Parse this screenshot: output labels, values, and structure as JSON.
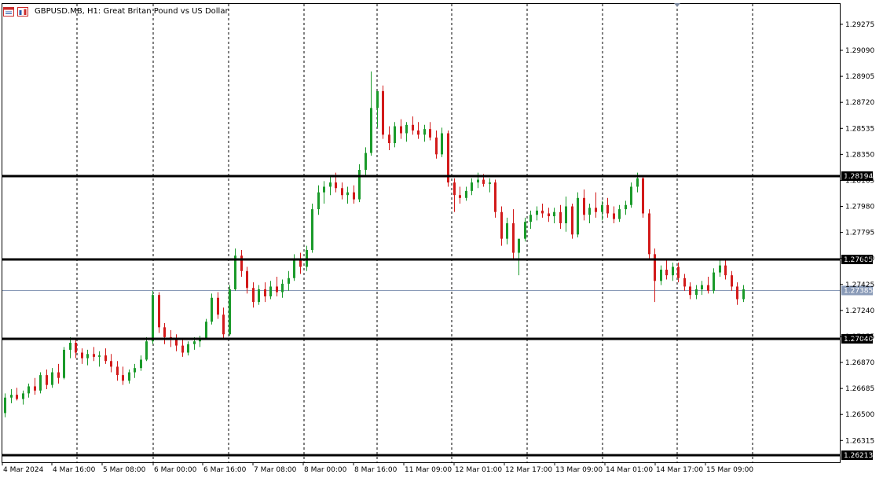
{
  "window": {
    "symbol_line": "GBPUSD.MB, H1:  Great Britan Pound vs US Dollar",
    "icons": [
      "chart-type-icon",
      "one-click-trading-icon"
    ]
  },
  "colors": {
    "background": "#ffffff",
    "bull": "#1a9a2a",
    "bear": "#d21a1a",
    "level_line": "#000000",
    "bid_line": "#8a9bb8",
    "grid": "#000000"
  },
  "chart_data": {
    "type": "candlestick",
    "symbol": "GBPUSD.MB",
    "timeframe": "H1",
    "title": "Great Britan Pound vs US Dollar",
    "y_ticks": [
      "1.29275",
      "1.29090",
      "1.28905",
      "1.28720",
      "1.28535",
      "1.28350",
      "1.28165",
      "1.27980",
      "1.27795",
      "1.27610",
      "1.27425",
      "1.27240",
      "1.27055",
      "1.26870",
      "1.26685",
      "1.26500",
      "1.26315"
    ],
    "ylim": [
      1.2616,
      1.2942
    ],
    "x_ticks": [
      "4 Mar 2024",
      "4 Mar 16:00",
      "5 Mar 08:00",
      "6 Mar 00:00",
      "6 Mar 16:00",
      "7 Mar 08:00",
      "8 Mar 00:00",
      "8 Mar 16:00",
      "11 Mar 09:00",
      "12 Mar 01:00",
      "12 Mar 17:00",
      "13 Mar 09:00",
      "14 Mar 01:00",
      "14 Mar 17:00",
      "15 Mar 09:00"
    ],
    "horizontal_levels": [
      {
        "price": 1.28194,
        "label": "1.28194"
      },
      {
        "price": 1.27605,
        "label": "1.27605"
      },
      {
        "price": 1.2704,
        "label": "1.27040"
      },
      {
        "price": 1.26213,
        "label": "1.26213"
      }
    ],
    "current_bid": {
      "price": 1.27385,
      "label": "1.27385"
    },
    "candles": [
      [
        1.2651,
        1.2665,
        1.2648,
        1.2662
      ],
      [
        1.2662,
        1.2668,
        1.2658,
        1.2664
      ],
      [
        1.2664,
        1.2669,
        1.266,
        1.2661
      ],
      [
        1.2661,
        1.2667,
        1.2657,
        1.2665
      ],
      [
        1.2665,
        1.2672,
        1.2662,
        1.267
      ],
      [
        1.267,
        1.2676,
        1.2664,
        1.2667
      ],
      [
        1.2667,
        1.268,
        1.2665,
        1.2678
      ],
      [
        1.2678,
        1.2682,
        1.2668,
        1.2671
      ],
      [
        1.2671,
        1.2683,
        1.2669,
        1.268
      ],
      [
        1.268,
        1.2686,
        1.2672,
        1.2676
      ],
      [
        1.2676,
        1.2698,
        1.2675,
        1.2696
      ],
      [
        1.2696,
        1.2705,
        1.269,
        1.2701
      ],
      [
        1.2701,
        1.2704,
        1.269,
        1.2694
      ],
      [
        1.2694,
        1.2697,
        1.2686,
        1.269
      ],
      [
        1.269,
        1.2696,
        1.2685,
        1.2693
      ],
      [
        1.2693,
        1.2698,
        1.2688,
        1.2691
      ],
      [
        1.2691,
        1.2695,
        1.2684,
        1.2692
      ],
      [
        1.2692,
        1.2697,
        1.2686,
        1.2688
      ],
      [
        1.2688,
        1.2693,
        1.268,
        1.2684
      ],
      [
        1.2684,
        1.2688,
        1.2674,
        1.2678
      ],
      [
        1.2678,
        1.2684,
        1.2671,
        1.2674
      ],
      [
        1.2674,
        1.2682,
        1.2672,
        1.268
      ],
      [
        1.268,
        1.2686,
        1.2676,
        1.2683
      ],
      [
        1.2683,
        1.2692,
        1.2681,
        1.2689
      ],
      [
        1.2689,
        1.2705,
        1.2688,
        1.2702
      ],
      [
        1.2702,
        1.2738,
        1.27,
        1.2735
      ],
      [
        1.2735,
        1.2737,
        1.2708,
        1.2712
      ],
      [
        1.2712,
        1.2715,
        1.27,
        1.2705
      ],
      [
        1.2705,
        1.271,
        1.2698,
        1.2703
      ],
      [
        1.2703,
        1.2707,
        1.2695,
        1.2699
      ],
      [
        1.2699,
        1.2703,
        1.2691,
        1.2694
      ],
      [
        1.2694,
        1.2702,
        1.2692,
        1.27
      ],
      [
        1.27,
        1.2705,
        1.2696,
        1.2702
      ],
      [
        1.2702,
        1.2706,
        1.2698,
        1.2704
      ],
      [
        1.2704,
        1.2718,
        1.2703,
        1.2716
      ],
      [
        1.2716,
        1.2736,
        1.2714,
        1.2733
      ],
      [
        1.2733,
        1.2737,
        1.2718,
        1.2721
      ],
      [
        1.2721,
        1.2726,
        1.2704,
        1.2707
      ],
      [
        1.2707,
        1.2742,
        1.2706,
        1.2739
      ],
      [
        1.2739,
        1.2768,
        1.2738,
        1.2763
      ],
      [
        1.2763,
        1.2767,
        1.2748,
        1.2752
      ],
      [
        1.2752,
        1.2755,
        1.2736,
        1.274
      ],
      [
        1.274,
        1.2744,
        1.2726,
        1.273
      ],
      [
        1.273,
        1.2742,
        1.2728,
        1.2739
      ],
      [
        1.2739,
        1.2744,
        1.273,
        1.2734
      ],
      [
        1.2734,
        1.2745,
        1.2732,
        1.2741
      ],
      [
        1.2741,
        1.2748,
        1.2734,
        1.2737
      ],
      [
        1.2737,
        1.2746,
        1.2733,
        1.2743
      ],
      [
        1.2743,
        1.2752,
        1.2738,
        1.2747
      ],
      [
        1.2747,
        1.2764,
        1.2745,
        1.2761
      ],
      [
        1.2761,
        1.2765,
        1.275,
        1.2755
      ],
      [
        1.2755,
        1.277,
        1.2752,
        1.2767
      ],
      [
        1.2767,
        1.28,
        1.2765,
        1.2796
      ],
      [
        1.2796,
        1.2813,
        1.2792,
        1.2808
      ],
      [
        1.2808,
        1.2816,
        1.28,
        1.2812
      ],
      [
        1.2812,
        1.2819,
        1.2806,
        1.2815
      ],
      [
        1.2815,
        1.2822,
        1.2808,
        1.2811
      ],
      [
        1.2811,
        1.2815,
        1.2803,
        1.2806
      ],
      [
        1.2806,
        1.2812,
        1.28,
        1.2808
      ],
      [
        1.2808,
        1.2813,
        1.28,
        1.2803
      ],
      [
        1.2803,
        1.2828,
        1.2801,
        1.2824
      ],
      [
        1.2824,
        1.284,
        1.282,
        1.2836
      ],
      [
        1.2836,
        1.2894,
        1.2834,
        1.2868
      ],
      [
        1.2868,
        1.2874,
        1.2854,
        1.288
      ],
      [
        1.288,
        1.2884,
        1.2846,
        1.2849
      ],
      [
        1.2849,
        1.2855,
        1.2838,
        1.2843
      ],
      [
        1.2843,
        1.2858,
        1.284,
        1.2855
      ],
      [
        1.2855,
        1.286,
        1.2846,
        1.285
      ],
      [
        1.285,
        1.2858,
        1.2844,
        1.2856
      ],
      [
        1.2856,
        1.2862,
        1.2849,
        1.2852
      ],
      [
        1.2852,
        1.2858,
        1.2846,
        1.2849
      ],
      [
        1.2849,
        1.2856,
        1.2844,
        1.2853
      ],
      [
        1.2853,
        1.2858,
        1.2845,
        1.2847
      ],
      [
        1.2847,
        1.2852,
        1.2832,
        1.2835
      ],
      [
        1.2835,
        1.2854,
        1.2833,
        1.285
      ],
      [
        1.285,
        1.2852,
        1.2812,
        1.2815
      ],
      [
        1.2815,
        1.2818,
        1.2794,
        1.2806
      ],
      [
        1.2806,
        1.2812,
        1.28,
        1.2804
      ],
      [
        1.2804,
        1.2812,
        1.2802,
        1.2809
      ],
      [
        1.2809,
        1.2818,
        1.2806,
        1.2815
      ],
      [
        1.2815,
        1.2822,
        1.2811,
        1.2817
      ],
      [
        1.2817,
        1.2821,
        1.2812,
        1.2814
      ],
      [
        1.2814,
        1.2818,
        1.2808,
        1.2815
      ],
      [
        1.2815,
        1.2817,
        1.279,
        1.2794
      ],
      [
        1.2794,
        1.2798,
        1.277,
        1.2775
      ],
      [
        1.2775,
        1.279,
        1.2771,
        1.2786
      ],
      [
        1.2786,
        1.2796,
        1.276,
        1.2765
      ],
      [
        1.2765,
        1.277,
        1.2749,
        1.2775
      ],
      [
        1.2775,
        1.279,
        1.2773,
        1.2787
      ],
      [
        1.2787,
        1.2795,
        1.2782,
        1.2792
      ],
      [
        1.2792,
        1.2798,
        1.2788,
        1.2795
      ],
      [
        1.2795,
        1.28,
        1.279,
        1.2793
      ],
      [
        1.2793,
        1.2797,
        1.2787,
        1.2791
      ],
      [
        1.2791,
        1.2797,
        1.2786,
        1.2794
      ],
      [
        1.2794,
        1.2799,
        1.2782,
        1.2786
      ],
      [
        1.2786,
        1.2805,
        1.278,
        1.2798
      ],
      [
        1.2798,
        1.28,
        1.2775,
        1.2778
      ],
      [
        1.2778,
        1.2808,
        1.2776,
        1.2804
      ],
      [
        1.2804,
        1.281,
        1.2788,
        1.2792
      ],
      [
        1.2792,
        1.28,
        1.2786,
        1.2797
      ],
      [
        1.2797,
        1.2808,
        1.279,
        1.2794
      ],
      [
        1.2794,
        1.2802,
        1.2788,
        1.2799
      ],
      [
        1.2799,
        1.2804,
        1.279,
        1.2793
      ],
      [
        1.2793,
        1.2798,
        1.2786,
        1.2789
      ],
      [
        1.2789,
        1.2799,
        1.2787,
        1.2796
      ],
      [
        1.2796,
        1.2802,
        1.2792,
        1.2799
      ],
      [
        1.2799,
        1.2815,
        1.2797,
        1.2812
      ],
      [
        1.2812,
        1.2822,
        1.2808,
        1.2818
      ],
      [
        1.2818,
        1.282,
        1.279,
        1.2793
      ],
      [
        1.2793,
        1.2796,
        1.276,
        1.2764
      ],
      [
        1.2764,
        1.2768,
        1.273,
        1.2745
      ],
      [
        1.2745,
        1.2756,
        1.2742,
        1.2753
      ],
      [
        1.2753,
        1.276,
        1.2746,
        1.2749
      ],
      [
        1.2749,
        1.2758,
        1.2745,
        1.2755
      ],
      [
        1.2755,
        1.2758,
        1.2744,
        1.2747
      ],
      [
        1.2747,
        1.275,
        1.2738,
        1.2741
      ],
      [
        1.2741,
        1.2744,
        1.2732,
        1.2735
      ],
      [
        1.2735,
        1.2742,
        1.2732,
        1.2739
      ],
      [
        1.2739,
        1.2745,
        1.2735,
        1.2742
      ],
      [
        1.2742,
        1.2748,
        1.2736,
        1.2738
      ],
      [
        1.2738,
        1.2754,
        1.2736,
        1.2751
      ],
      [
        1.2751,
        1.276,
        1.2748,
        1.2756
      ],
      [
        1.2756,
        1.276,
        1.2746,
        1.2749
      ],
      [
        1.2749,
        1.2752,
        1.2738,
        1.2741
      ],
      [
        1.2741,
        1.2744,
        1.2728,
        1.2732
      ],
      [
        1.2732,
        1.2742,
        1.273,
        1.2739
      ]
    ]
  }
}
